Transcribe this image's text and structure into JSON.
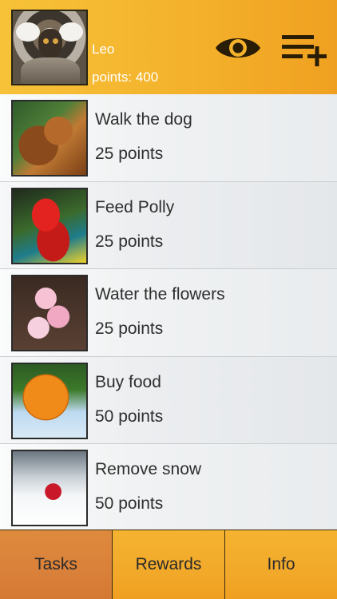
{
  "header": {
    "user_name": "Leo",
    "points_text": "points: 400",
    "eye_icon": "eye-icon",
    "add_list_icon": "playlist-add-icon",
    "background_color": "#f4b22c"
  },
  "tasks": [
    {
      "title": "Walk the dog",
      "points": "25 points",
      "thumb": "dog"
    },
    {
      "title": "Feed Polly",
      "points": "25 points",
      "thumb": "parrot"
    },
    {
      "title": "Water the flowers",
      "points": "25 points",
      "thumb": "flower"
    },
    {
      "title": "Buy food",
      "points": "50 points",
      "thumb": "orange"
    },
    {
      "title": "Remove snow",
      "points": "50 points",
      "thumb": "snow"
    }
  ],
  "tabs": [
    {
      "label": "Tasks",
      "active": true
    },
    {
      "label": "Rewards",
      "active": false
    },
    {
      "label": "Info",
      "active": false
    }
  ],
  "colors": {
    "accent": "#f4b22c",
    "active_tab": "#d9803a",
    "text_dark": "#2e2e2e"
  }
}
